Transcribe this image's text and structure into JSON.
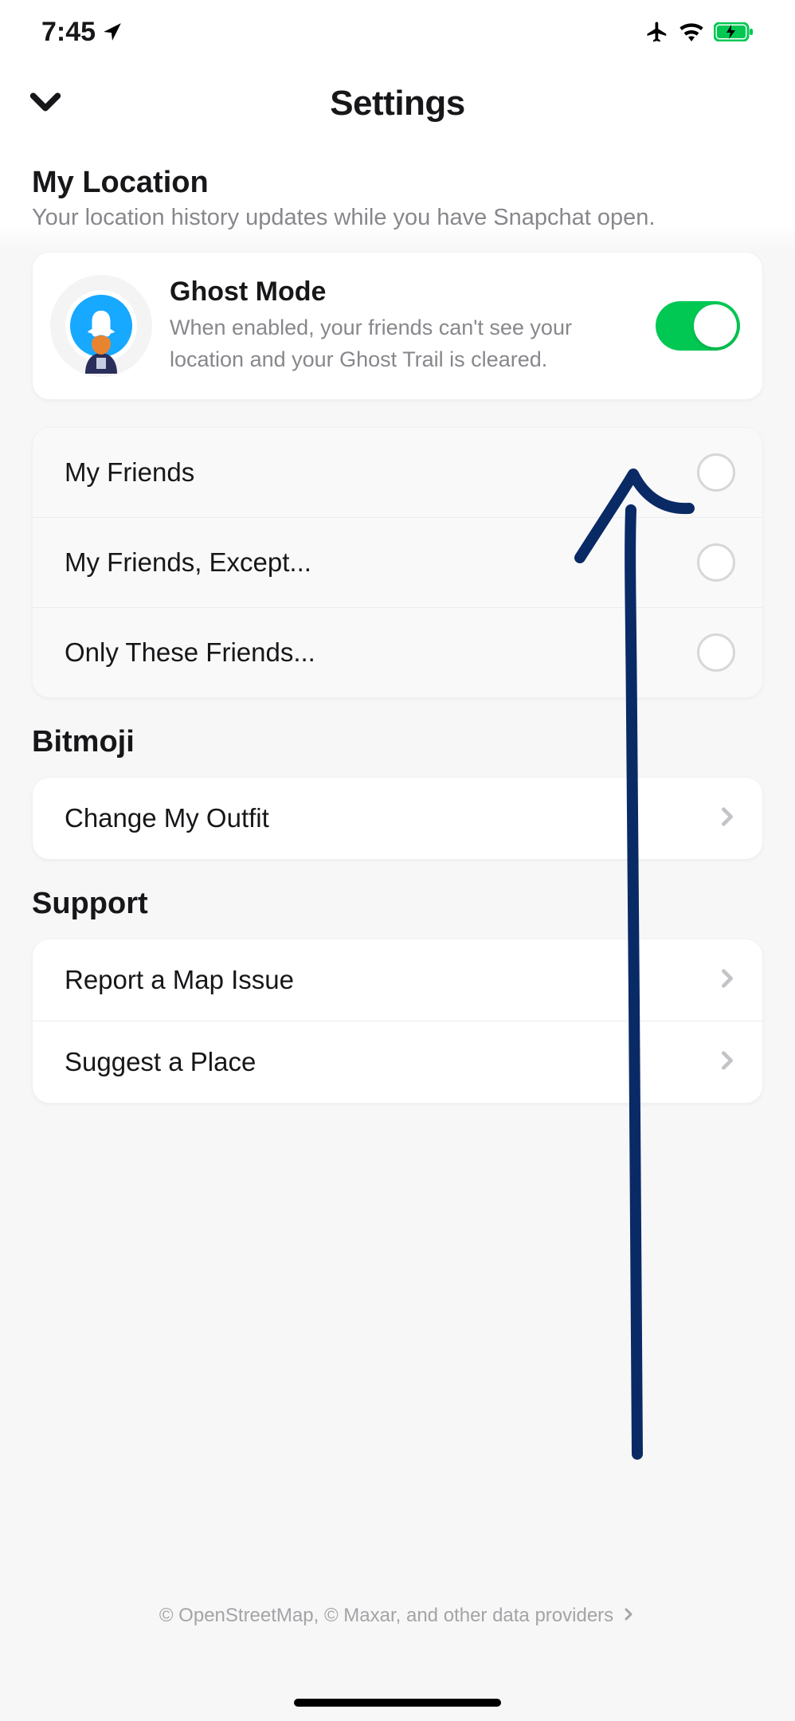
{
  "status": {
    "time": "7:45",
    "airplane": true,
    "wifi": true,
    "battery_charging": true
  },
  "header": {
    "title": "Settings"
  },
  "sections": {
    "location": {
      "title": "My Location",
      "subtitle": "Your location history updates while you have Snapchat open.",
      "ghost": {
        "title": "Ghost Mode",
        "desc": "When enabled, your friends can't see your location and your Ghost Trail is cleared.",
        "enabled": true
      },
      "options": [
        {
          "label": "My Friends",
          "selected": false
        },
        {
          "label": "My Friends, Except...",
          "selected": false
        },
        {
          "label": "Only These Friends...",
          "selected": false
        }
      ]
    },
    "bitmoji": {
      "title": "Bitmoji",
      "items": [
        {
          "label": "Change My Outfit"
        }
      ]
    },
    "support": {
      "title": "Support",
      "items": [
        {
          "label": "Report a Map Issue"
        },
        {
          "label": "Suggest a Place"
        }
      ]
    }
  },
  "footer": {
    "text": "© OpenStreetMap, © Maxar, and other data providers"
  }
}
